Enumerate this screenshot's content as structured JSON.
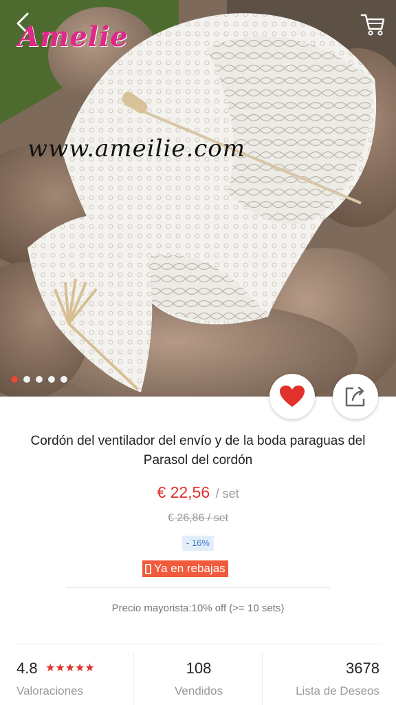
{
  "header": {
    "logo_text": "Amelie",
    "watermark": "www.ameilie.com"
  },
  "gallery": {
    "total_images": 5,
    "active_index": 0
  },
  "product": {
    "title": "Cordón del ventilador del envío y de la boda paraguas del Parasol del cordón",
    "price": "€ 22,56",
    "price_unit": "/ set",
    "old_price": "€ 26,86 / set",
    "discount": "- 16%",
    "sale_label": "Ya en rebajas",
    "wholesale": "Precio mayorista:10% off (>= 10 sets)"
  },
  "stats": {
    "rating": "4.8",
    "rating_label": "Valoraciones",
    "stars": "★★★★★",
    "sold": "108",
    "sold_label": "Vendidos",
    "wishlist": "3678",
    "wishlist_label": "Lista de Deseos"
  },
  "colors": {
    "accent": "#e0312a",
    "logo": "#e0288a",
    "sale_badge": "#f15a3a",
    "discount_bg": "#e3eefb"
  },
  "icons": {
    "back": "chevron-left-icon",
    "cart": "cart-icon",
    "favorite": "heart-icon",
    "share": "share-icon"
  }
}
